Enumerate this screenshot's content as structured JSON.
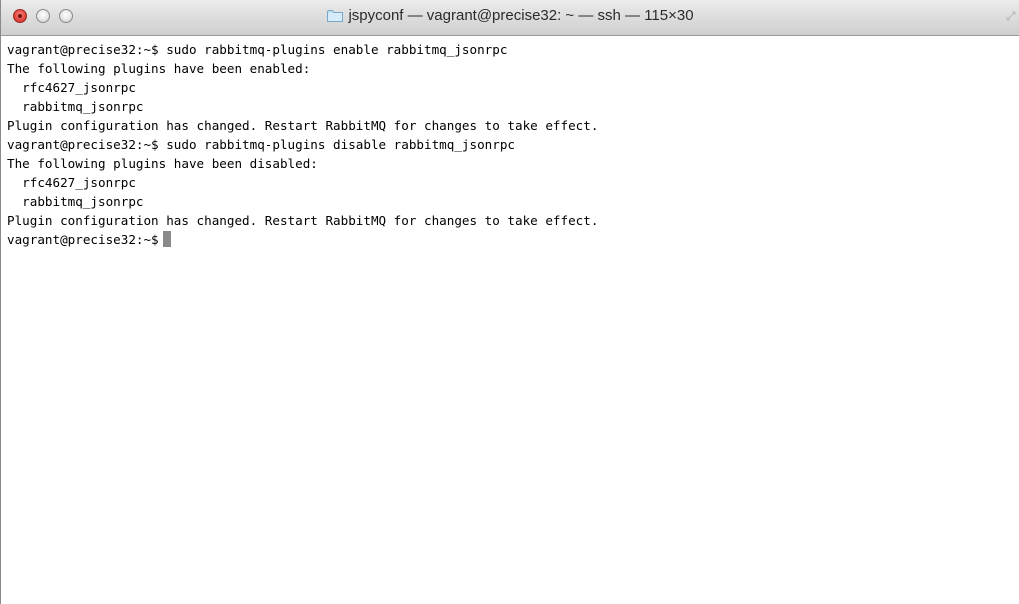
{
  "window": {
    "title": "jspyconf — vagrant@precise32: ~ — ssh — 115×30",
    "controls": {
      "close": "close-icon",
      "minimize": "minimize-icon",
      "zoom": "zoom-icon"
    },
    "folder_icon": "folder-icon",
    "resize_icon": "fullscreen-icon"
  },
  "terminal": {
    "lines": [
      "vagrant@precise32:~$ sudo rabbitmq-plugins enable rabbitmq_jsonrpc",
      "The following plugins have been enabled:",
      "  rfc4627_jsonrpc",
      "  rabbitmq_jsonrpc",
      "Plugin configuration has changed. Restart RabbitMQ for changes to take effect.",
      "vagrant@precise32:~$ sudo rabbitmq-plugins disable rabbitmq_jsonrpc",
      "The following plugins have been disabled:",
      "  rfc4627_jsonrpc",
      "  rabbitmq_jsonrpc",
      "Plugin configuration has changed. Restart RabbitMQ for changes to take effect."
    ],
    "prompt": "vagrant@precise32:~$"
  },
  "colors": {
    "background": "#ffffff",
    "text": "#000000",
    "cursor": "#8a8a8a",
    "close_button": "#e0443e"
  }
}
